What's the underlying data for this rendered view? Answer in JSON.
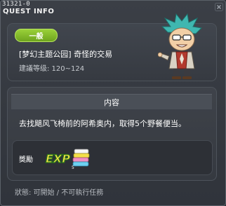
{
  "window": {
    "quest_id": "31321-0",
    "title": "QUEST INFO"
  },
  "quest": {
    "category": "一般",
    "name": "[梦幻主题公园] 奇怪的交易",
    "level": "建議等级: 120~124"
  },
  "content": {
    "header": "内容",
    "description": "去找飓风飞椅前的阿希奥内，取得5个野餐便当。"
  },
  "reward": {
    "label": "獎勵",
    "icon": "exp-icon",
    "icon_text": "EXP"
  },
  "status": {
    "text": "狀態: 可開始 / 不可執行任務"
  },
  "colors": {
    "badge": "#7fb82a",
    "text": "#ffffff"
  }
}
